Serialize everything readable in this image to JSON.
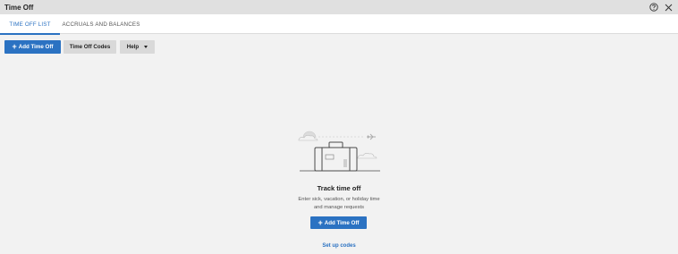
{
  "window": {
    "title": "Time Off",
    "help_icon": "help-circle-icon",
    "close_icon": "close-icon"
  },
  "tabs": [
    {
      "label": "TIME OFF LIST",
      "active": true
    },
    {
      "label": "ACCRUALS AND BALANCES",
      "active": false
    }
  ],
  "toolbar": {
    "add_label": "Add Time Off",
    "codes_label": "Time Off Codes",
    "help_label": "Help"
  },
  "empty_state": {
    "illustration_icon": "suitcase-travel-icon",
    "title": "Track time off",
    "description_line1": "Enter sick, vacation, or holiday time",
    "description_line2": "and manage requests",
    "cta_label": "Add Time Off",
    "setup_link": "Set up codes"
  },
  "colors": {
    "accent": "#2b72c2",
    "titlebar_bg": "#e0e0e0",
    "page_bg": "#f2f2f2"
  }
}
